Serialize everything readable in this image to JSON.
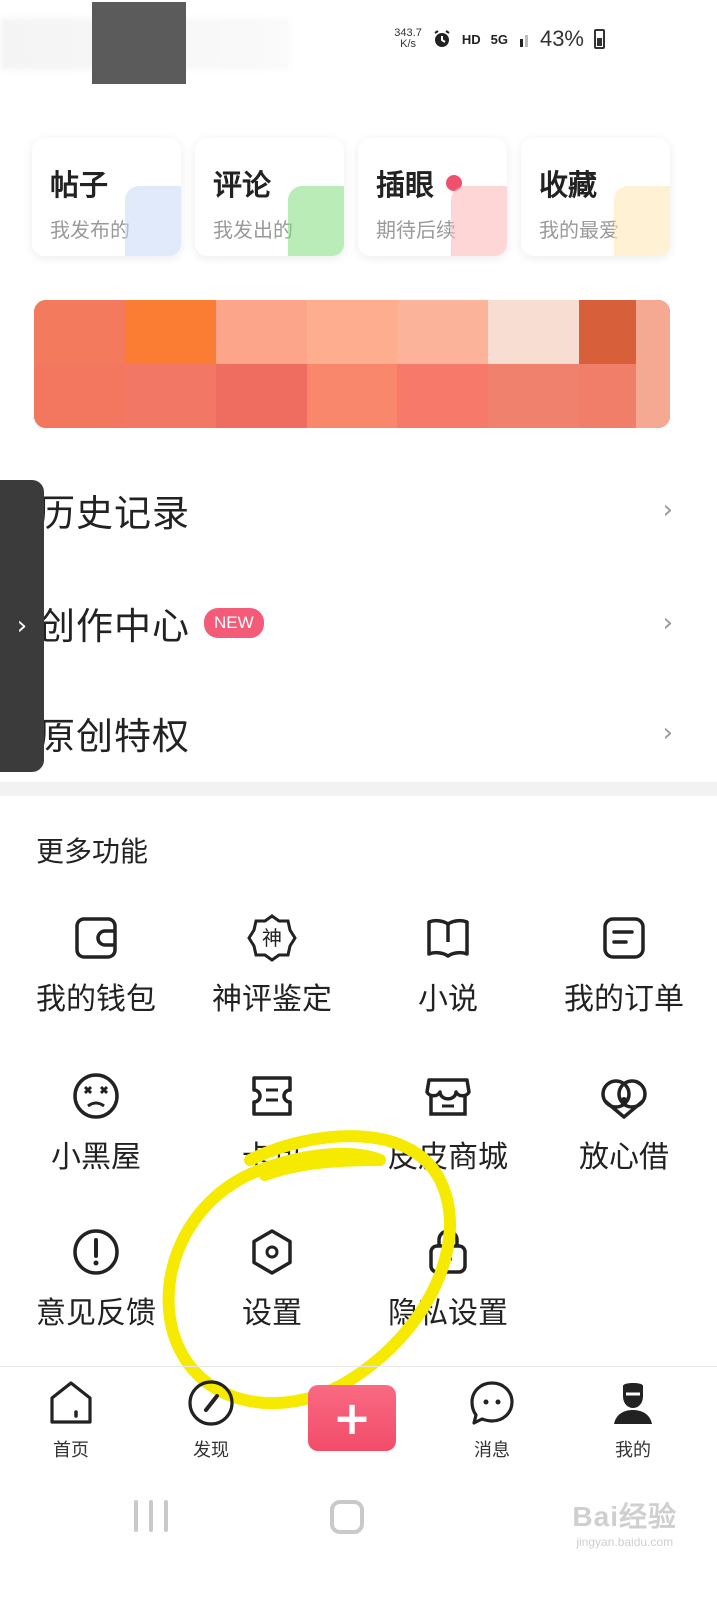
{
  "status_bar": {
    "net_speed_value": "343.7",
    "net_speed_unit": "K/s",
    "alarm_icon": "alarm-clock-icon",
    "hd_label": "HD",
    "signal_label": "5G",
    "battery_percent": "43%"
  },
  "quick_cards": [
    {
      "title": "帖子",
      "subtitle": "我发布的"
    },
    {
      "title": "评论",
      "subtitle": "我发出的"
    },
    {
      "title": "插眼",
      "subtitle": "期待后续"
    },
    {
      "title": "收藏",
      "subtitle": "我的最爱"
    }
  ],
  "menu": {
    "history": "历史记录",
    "creation_center": "创作中心",
    "creation_badge": "NEW",
    "original_privilege": "原创特权"
  },
  "more_functions": {
    "title": "更多功能",
    "items": [
      {
        "label": "我的钱包",
        "icon": "wallet-icon"
      },
      {
        "label": "神评鉴定",
        "icon": "god-comment-badge-icon"
      },
      {
        "label": "小说",
        "icon": "book-icon"
      },
      {
        "label": "我的订单",
        "icon": "order-icon"
      },
      {
        "label": "小黑屋",
        "icon": "dizzy-face-icon"
      },
      {
        "label": "卡包",
        "icon": "ticket-icon"
      },
      {
        "label": "皮皮商城",
        "icon": "shop-icon"
      },
      {
        "label": "放心借",
        "icon": "loan-icon"
      },
      {
        "label": "意见反馈",
        "icon": "feedback-icon"
      },
      {
        "label": "设置",
        "icon": "settings-icon"
      },
      {
        "label": "隐私设置",
        "icon": "lock-icon"
      }
    ]
  },
  "bottom_nav": {
    "home": "首页",
    "discover": "发现",
    "publish": "+",
    "messages": "消息",
    "mine": "我的"
  },
  "watermark": {
    "main": "Bai经验",
    "sub": "jingyan.baidu.com"
  },
  "colors": {
    "accent": "#f24c6a",
    "badge": "#f35b78",
    "annotation": "#f5ea00"
  }
}
